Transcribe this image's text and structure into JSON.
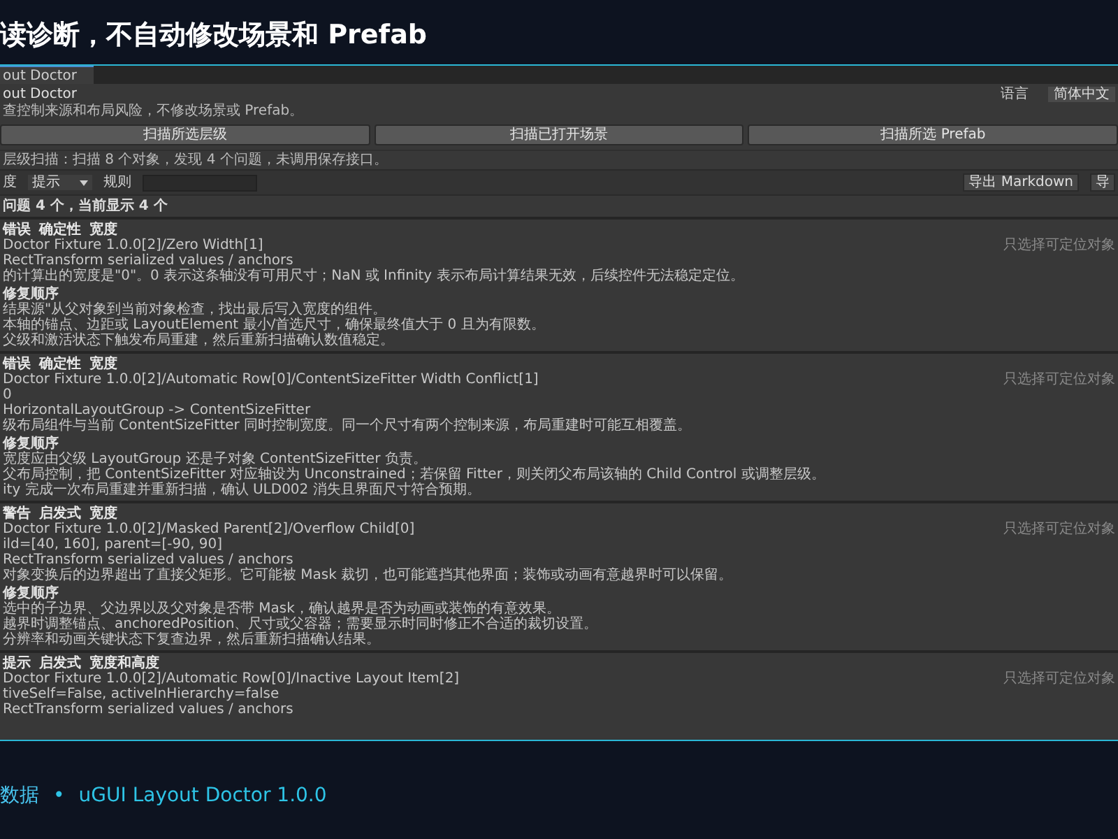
{
  "heading": "读诊断，不自动修改场景和 Prefab",
  "window": {
    "tab": "out Doctor",
    "title": "out Doctor",
    "description": "查控制来源和布局风险，不修改场景或 Prefab。",
    "language_label": "语言",
    "language_value": "简体中文",
    "scan_buttons": [
      "扫描所选层级",
      "扫描已打开场景",
      "扫描所选 Prefab"
    ],
    "scan_status": "层级扫描：扫描 8 个对象，发现 4 个问题，未调用保存接口。",
    "filter": {
      "severity_label": "度",
      "severity_value": "提示",
      "rule_label": "规则"
    },
    "export_buttons": [
      "导出 Markdown",
      "导"
    ],
    "count": "问题 4 个，当前显示 4 个",
    "issues": [
      {
        "tags": [
          "错误",
          "确定性",
          "宽度"
        ],
        "path": "Doctor Fixture 1.0.0[2]/Zero Width[1]",
        "hint": "只选择可定位对象",
        "details": [
          "RectTransform serialized values / anchors",
          "的计算出的宽度是\"0\"。0 表示这条轴没有可用尺寸；NaN 或 Infinity 表示布局计算结果无效，后续控件无法稳定定位。"
        ],
        "fix_title": "修复顺序",
        "fix_steps": [
          "结果源\"从父对象到当前对象检查，找出最后写入宽度的组件。",
          "本轴的锚点、边距或 LayoutElement 最小/首选尺寸，确保最终值大于 0 且为有限数。",
          "父级和激活状态下触发布局重建，然后重新扫描确认数值稳定。"
        ]
      },
      {
        "tags": [
          "错误",
          "确定性",
          "宽度"
        ],
        "path": "Doctor Fixture 1.0.0[2]/Automatic Row[0]/ContentSizeFitter Width Conflict[1]",
        "hint": "只选择可定位对象",
        "details": [
          "0",
          "HorizontalLayoutGroup -> ContentSizeFitter",
          "级布局组件与当前 ContentSizeFitter 同时控制宽度。同一个尺寸有两个控制来源，布局重建时可能互相覆盖。"
        ],
        "fix_title": "修复顺序",
        "fix_steps": [
          "宽度应由父级 LayoutGroup 还是子对象 ContentSizeFitter 负责。",
          "父布局控制，把 ContentSizeFitter 对应轴设为 Unconstrained；若保留 Fitter，则关闭父布局该轴的 Child Control 或调整层级。",
          "ity 完成一次布局重建并重新扫描，确认 ULD002 消失且界面尺寸符合预期。"
        ]
      },
      {
        "tags": [
          "警告",
          "启发式",
          "宽度"
        ],
        "path": "Doctor Fixture 1.0.0[2]/Masked Parent[2]/Overflow Child[0]",
        "hint": "只选择可定位对象",
        "details": [
          "ild=[40, 160], parent=[-90, 90]",
          "RectTransform serialized values / anchors",
          "对象变换后的边界超出了直接父矩形。它可能被 Mask 裁切，也可能遮挡其他界面；装饰或动画有意越界时可以保留。"
        ],
        "fix_title": "修复顺序",
        "fix_steps": [
          "选中的子边界、父边界以及父对象是否带 Mask，确认越界是否为动画或装饰的有意效果。",
          "越界时调整锚点、anchoredPosition、尺寸或父容器；需要显示时同时修正不合适的裁切设置。",
          "分辨率和动画关键状态下复查边界，然后重新扫描确认结果。"
        ]
      },
      {
        "tags": [
          "提示",
          "启发式",
          "宽度和高度"
        ],
        "path": "Doctor Fixture 1.0.0[2]/Automatic Row[0]/Inactive Layout Item[2]",
        "hint": "只选择可定位对象",
        "details": [
          "tiveSelf=False, activeInHierarchy=false",
          "RectTransform serialized values / anchors"
        ]
      }
    ]
  },
  "footer": {
    "source": "数据",
    "separator": "•",
    "product": "uGUI Layout Doctor 1.0.0"
  }
}
